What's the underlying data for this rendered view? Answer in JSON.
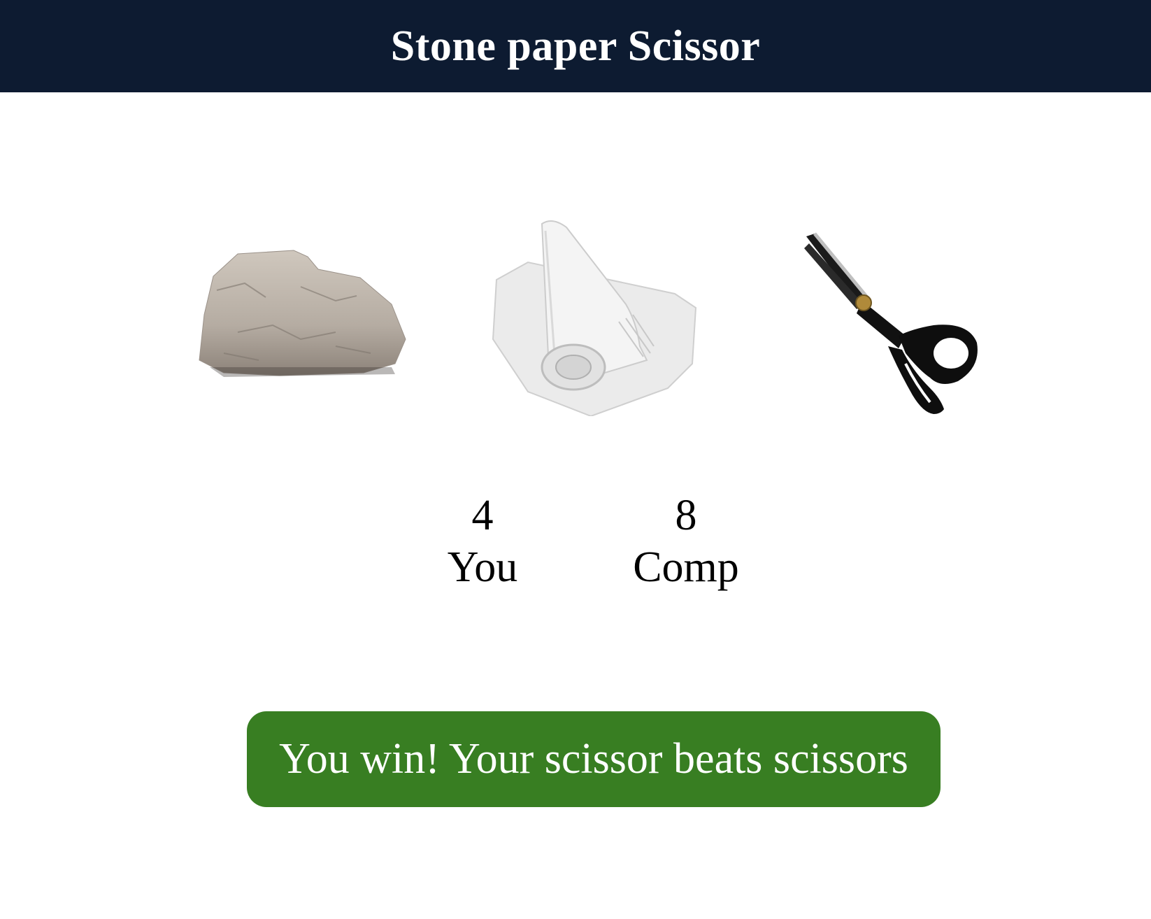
{
  "header": {
    "title": "Stone paper Scissor",
    "background": "#0d1b31"
  },
  "choices": [
    {
      "id": "stone",
      "icon": "stone-icon"
    },
    {
      "id": "paper",
      "icon": "paper-icon"
    },
    {
      "id": "scissor",
      "icon": "scissor-icon"
    }
  ],
  "scoreboard": {
    "user_score": "4",
    "user_label": "You",
    "comp_score": "8",
    "comp_label": "Comp"
  },
  "message": {
    "text": "You win! Your scissor beats scissors",
    "background": "#387e22"
  }
}
